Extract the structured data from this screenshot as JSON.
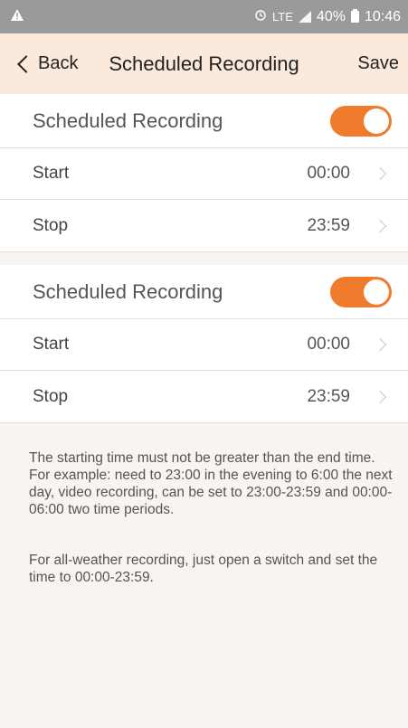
{
  "status_bar": {
    "alert_icon": "warning-icon",
    "alarm_icon": "alarm-icon",
    "network": "LTE",
    "battery": "40%",
    "time": "10:46"
  },
  "nav": {
    "back_label": "Back",
    "title": "Scheduled Recording",
    "save_label": "Save"
  },
  "schedules": [
    {
      "title": "Scheduled Recording",
      "enabled": true,
      "start_label": "Start",
      "start_value": "00:00",
      "stop_label": "Stop",
      "stop_value": "23:59"
    },
    {
      "title": "Scheduled Recording",
      "enabled": true,
      "start_label": "Start",
      "start_value": "00:00",
      "stop_label": "Stop",
      "stop_value": "23:59"
    }
  ],
  "help": {
    "paragraph1": "The starting time must not be greater than the end time. For example: need to 23:00 in the evening to 6:00 the next day, video recording, can be set to 23:00-23:59 and 00:00-06:00 two time periods.",
    "paragraph2": "For all-weather recording, just open a switch and set the time to 00:00-23:59."
  },
  "colors": {
    "accent": "#f07b2c",
    "nav_background": "#fbeadb",
    "status_bar": "#9a9a9a"
  }
}
